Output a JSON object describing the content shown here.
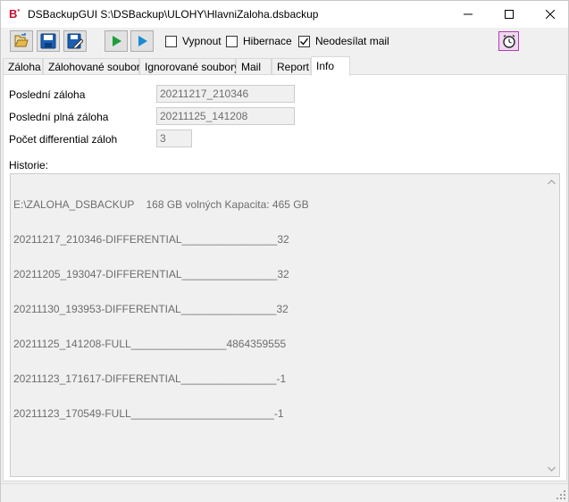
{
  "window": {
    "title": "DSBackupGUI S:\\DSBackup\\ULOHY\\HlavniZaloha.dsbackup",
    "logo_text": "B",
    "logo_mark": "*"
  },
  "toolbar": {
    "checkboxes": [
      {
        "label": "Vypnout",
        "checked": false
      },
      {
        "label": "Hibernace",
        "checked": false
      },
      {
        "label": "Neodesílat mail",
        "checked": true
      }
    ],
    "icons": [
      "open-icon",
      "save-icon",
      "edit-icon",
      "run-icon",
      "step-icon",
      "schedule-clock-icon"
    ]
  },
  "tabs": [
    {
      "label": "Záloha",
      "active": false
    },
    {
      "label": "Zálohované soubory",
      "active": false
    },
    {
      "label": "Ignorované soubory",
      "active": false
    },
    {
      "label": "Mail",
      "active": false
    },
    {
      "label": "Report",
      "active": false
    },
    {
      "label": "Info",
      "active": true
    }
  ],
  "info": {
    "last_backup_label": "Poslední záloha",
    "last_backup_value": "20211217_210346",
    "last_full_label": "Poslední plná záloha",
    "last_full_value": "20211125_141208",
    "diff_count_label": "Počet differential záloh",
    "diff_count_value": "3",
    "history_label": "Historie:",
    "history_lines": [
      "E:\\ZALOHA_DSBACKUP    168 GB volných Kapacita: 465 GB",
      "20211217_210346-DIFFERENTIAL________________32",
      "20211205_193047-DIFFERENTIAL________________32",
      "20211130_193953-DIFFERENTIAL________________32",
      "20211125_141208-FULL________________4864359555",
      "20211123_171617-DIFFERENTIAL________________-1",
      "20211123_170549-FULL________________________-1"
    ]
  },
  "colors": {
    "accent_green": "#1e9e3a",
    "accent_blue": "#1a8ad4",
    "logo_red": "#c8102e",
    "schedule_border": "#b23cb2"
  }
}
